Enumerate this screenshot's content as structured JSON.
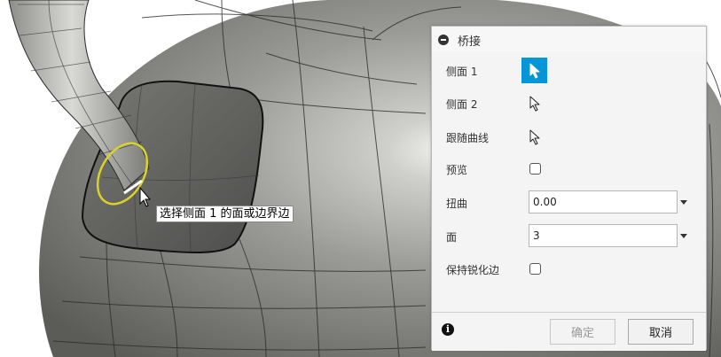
{
  "viewport": {
    "tooltip_text": "选择侧面 1 的面或边界边"
  },
  "panel": {
    "title": "桥接",
    "rows": {
      "side1": {
        "label": "侧面 1"
      },
      "side2": {
        "label": "侧面 2"
      },
      "follow_curve": {
        "label": "跟随曲线"
      },
      "preview": {
        "label": "预览",
        "checked": false
      },
      "twist": {
        "label": "扭曲",
        "value": "0.00"
      },
      "faces": {
        "label": "面",
        "value": "3"
      },
      "keep_sharp": {
        "label": "保持锐化边",
        "checked": false
      }
    },
    "footer": {
      "ok_label": "确定",
      "cancel_label": "取消"
    }
  },
  "colors": {
    "accent": "#0696d7",
    "selection_ring": "#d8d22a"
  }
}
